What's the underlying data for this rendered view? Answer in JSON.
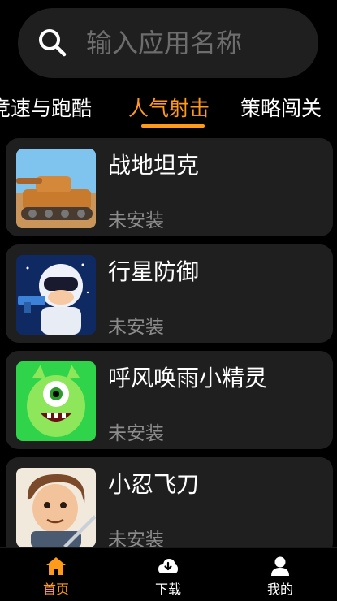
{
  "search": {
    "placeholder": "输入应用名称",
    "icon": "search-icon"
  },
  "tabs": [
    {
      "label": "竞速与跑酷",
      "active": false
    },
    {
      "label": "人气射击",
      "active": true
    },
    {
      "label": "策略闯关",
      "active": false
    }
  ],
  "accent_color": "#ff9a1a",
  "apps": [
    {
      "name": "战地坦克",
      "status": "未安装"
    },
    {
      "name": "行星防御",
      "status": "未安装"
    },
    {
      "name": "呼风唤雨小精灵",
      "status": "未安装"
    },
    {
      "name": "小忍飞刀",
      "status": "未安装"
    }
  ],
  "bottom_nav": [
    {
      "label": "首页",
      "icon": "home-icon",
      "active": true
    },
    {
      "label": "下载",
      "icon": "download-cloud-icon",
      "active": false
    },
    {
      "label": "我的",
      "icon": "user-icon",
      "active": false
    }
  ]
}
